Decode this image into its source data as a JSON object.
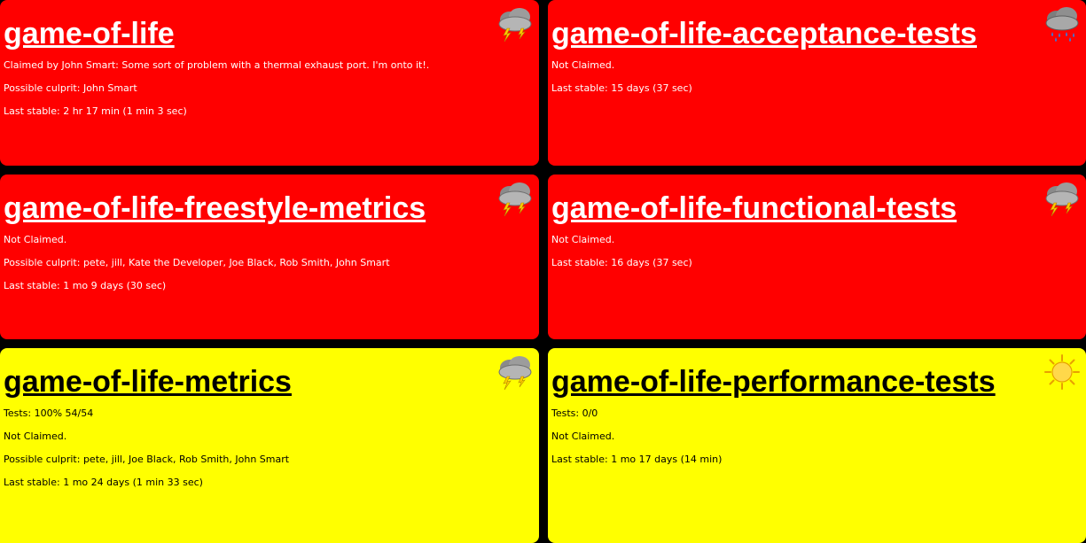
{
  "jobs": [
    {
      "name": "game-of-life",
      "status": "failed",
      "weather": "thunderstorm-icon",
      "lines": [
        "Claimed by John Smart: Some sort of problem with a thermal exhaust port. I'm onto it!.",
        "Possible culprit: John Smart",
        "Last stable: 2 hr 17 min (1 min 3 sec)"
      ]
    },
    {
      "name": "game-of-life-acceptance-tests",
      "status": "failed",
      "weather": "rain-cloud-icon",
      "lines": [
        "Not Claimed.",
        "Last stable: 15 days (37 sec)"
      ]
    },
    {
      "name": "game-of-life-freestyle-metrics",
      "status": "failed",
      "weather": "thunderstorm-icon",
      "lines": [
        "Not Claimed.",
        "Possible culprit: pete, jill, Kate the Developer, Joe Black, Rob Smith, John Smart",
        "Last stable: 1 mo 9 days (30 sec)"
      ]
    },
    {
      "name": "game-of-life-functional-tests",
      "status": "failed",
      "weather": "thunderstorm-icon",
      "lines": [
        "Not Claimed.",
        "Last stable: 16 days (37 sec)"
      ]
    },
    {
      "name": "game-of-life-metrics",
      "status": "unstable",
      "weather": "thunderstorm-icon",
      "lines": [
        "Tests: 100% 54/54",
        "Not Claimed.",
        "Possible culprit: pete, jill, Joe Black, Rob Smith, John Smart",
        "Last stable: 1 mo 24 days (1 min 33 sec)"
      ]
    },
    {
      "name": "game-of-life-performance-tests",
      "status": "unstable",
      "weather": "sun-icon",
      "lines": [
        "Tests: 0/0",
        "Not Claimed.",
        "Last stable: 1 mo 17 days (14 min)"
      ]
    }
  ],
  "colors": {
    "failed": "#ff0000",
    "unstable": "#ffff00",
    "background": "#000000"
  }
}
